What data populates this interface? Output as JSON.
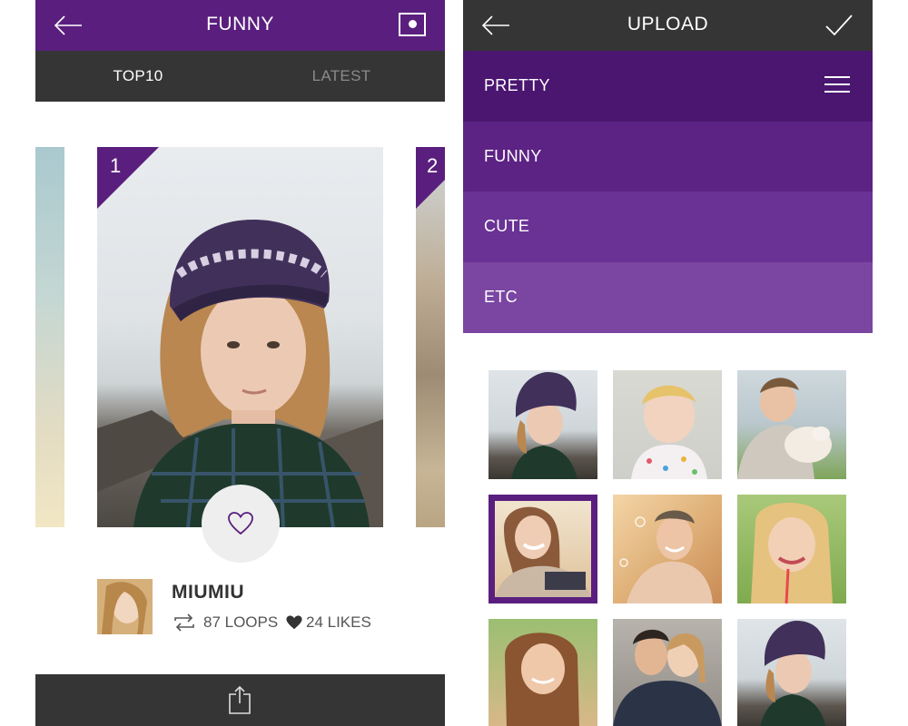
{
  "colors": {
    "brand_purple": "#5a1f7e",
    "dark_bar": "#353535"
  },
  "left_screen": {
    "header": {
      "back_icon": "arrow-left-icon",
      "title": "FUNNY",
      "record_icon": "record-icon"
    },
    "tabs": [
      {
        "label": "TOP10",
        "active": true
      },
      {
        "label": "LATEST",
        "active": false
      }
    ],
    "cards": [
      {
        "rank": "1"
      },
      {
        "rank": "2"
      }
    ],
    "like_button": {
      "icon": "heart-outline-icon"
    },
    "post": {
      "user_name": "MIUMIU",
      "loops_icon": "loop-icon",
      "loops": "87 LOOPS",
      "likes_icon": "heart-filled-icon",
      "likes": "24 LIKES"
    },
    "footer": {
      "share_icon": "share-icon"
    }
  },
  "right_screen": {
    "header": {
      "back_icon": "arrow-left-icon",
      "title": "UPLOAD",
      "confirm_icon": "checkmark-icon"
    },
    "categories": [
      {
        "label": "PRETTY",
        "color": "#4a1670",
        "menu_icon": "hamburger-menu-icon"
      },
      {
        "label": "FUNNY",
        "color": "#5c2284"
      },
      {
        "label": "CUTE",
        "color": "#693294"
      },
      {
        "label": "ETC",
        "color": "#7a46a2"
      }
    ],
    "gallery": {
      "selected_index": 3,
      "count": 9
    }
  }
}
